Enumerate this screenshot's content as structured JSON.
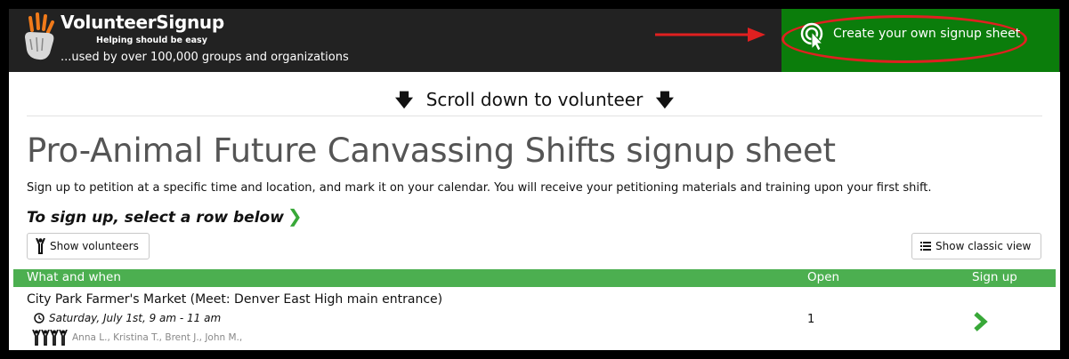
{
  "header": {
    "brand": "VolunteerSignup",
    "tagline": "Helping should be easy",
    "usage": "...used by over 100,000 groups and organizations",
    "cta_label": "Create your own signup sheet"
  },
  "banner": {
    "scroll_text": "Scroll down to volunteer"
  },
  "sheet": {
    "title": "Pro-Animal Future Canvassing Shifts signup sheet",
    "description": "Sign up to petition at a specific time and location, and mark it on your calendar. You will receive your petitioning materials and training upon your first shift.",
    "instruction": "To sign up, select a row below"
  },
  "buttons": {
    "show_volunteers": "Show volunteers",
    "show_classic": "Show classic view"
  },
  "table": {
    "headers": {
      "what": "What and when",
      "open": "Open",
      "signup": "Sign up"
    },
    "rows": [
      {
        "title": "City Park Farmer's Market (Meet: Denver East High main entrance)",
        "date": "Saturday, July 1st, 9 am - 11 am",
        "volunteers": "Anna L., Kristina T., Brent J., John M.,",
        "open": "1"
      }
    ]
  },
  "colors": {
    "topbar": "#222222",
    "cta_green": "#0b7d0b",
    "table_green": "#4caf50",
    "highlight_red": "#e02020",
    "chevron_green": "#38a838"
  }
}
